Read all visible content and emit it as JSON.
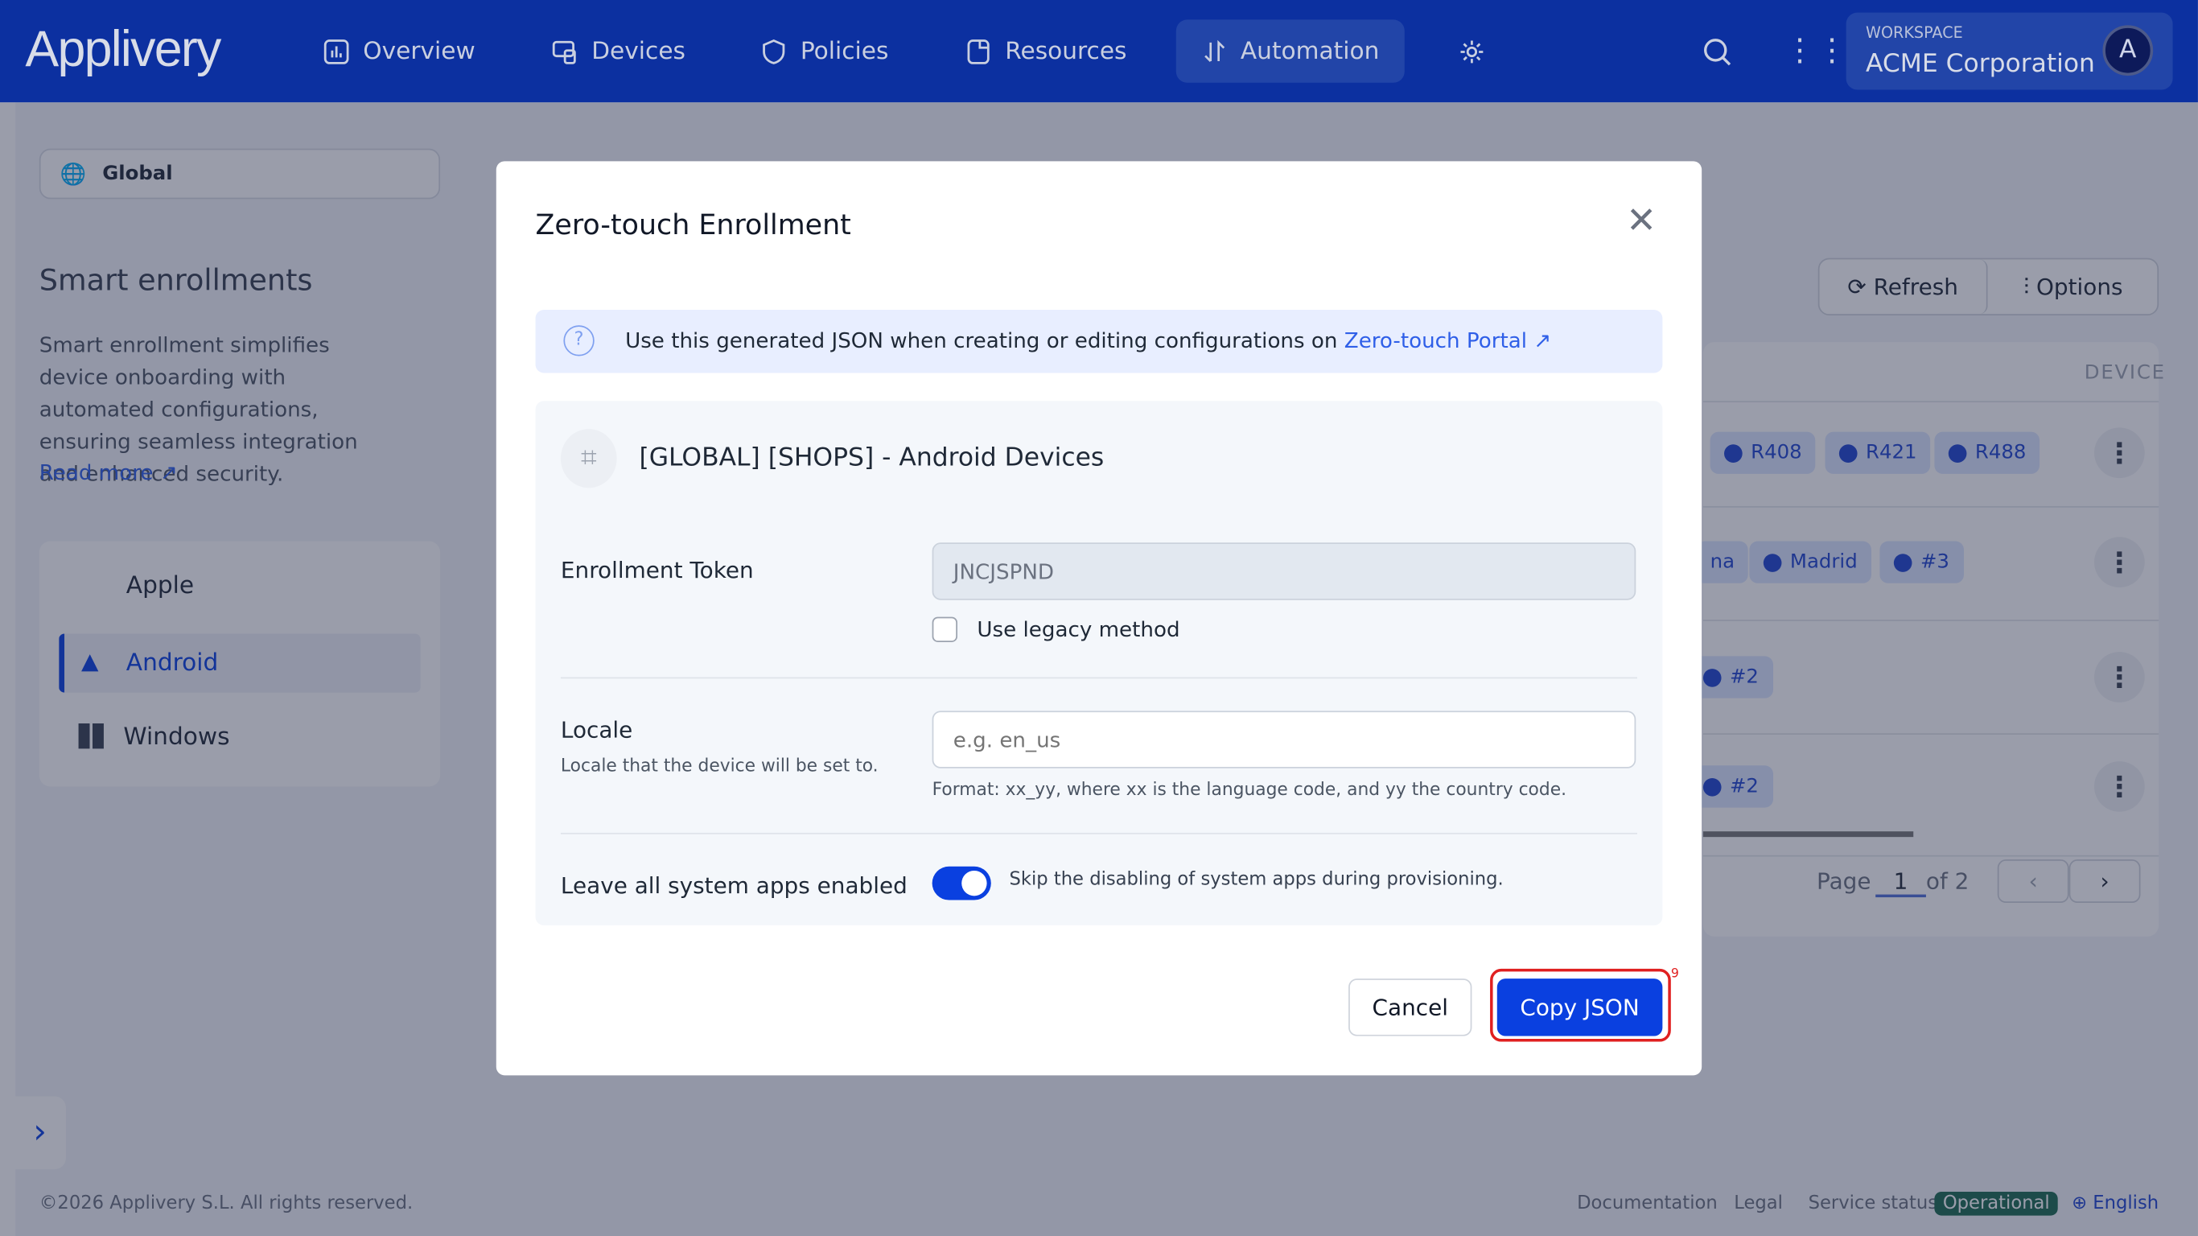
{
  "header": {
    "logo": "Applivery",
    "nav": [
      {
        "label": "Overview",
        "icon": "chart-icon"
      },
      {
        "label": "Devices",
        "icon": "devices-icon"
      },
      {
        "label": "Policies",
        "icon": "shield-icon"
      },
      {
        "label": "Resources",
        "icon": "folder-icon"
      },
      {
        "label": "Automation",
        "icon": "automation-icon",
        "active": true
      }
    ],
    "workspace_label": "WORKSPACE",
    "workspace_name": "ACME Corporation",
    "avatar": "A"
  },
  "sidebar": {
    "scope": "Global",
    "title": "Smart enrollments",
    "description": "Smart enrollment simplifies device onboarding with automated configurations, ensuring seamless integration and enhanced security.",
    "read_more": "Read more",
    "platforms": [
      {
        "label": "Apple"
      },
      {
        "label": "Android",
        "active": true
      },
      {
        "label": "Windows"
      }
    ]
  },
  "toolbar": {
    "refresh": "Refresh",
    "options": "Options"
  },
  "table": {
    "column": "DEVICE",
    "rows": [
      [
        "R408",
        "R421",
        "R488"
      ],
      [
        "na",
        "Madrid",
        "#3"
      ],
      [
        "#2"
      ],
      [
        "#2"
      ]
    ]
  },
  "pagination": {
    "page_label": "Page",
    "page": "1",
    "of": "of 2"
  },
  "footer": {
    "copyright": "©2026 Applivery S.L. All rights reserved.",
    "documentation": "Documentation",
    "legal": "Legal",
    "service_status": "Service status",
    "status": "Operational",
    "language": "English"
  },
  "modal": {
    "title": "Zero-touch Enrollment",
    "info": "Use this generated JSON when creating or editing configurations on ",
    "info_link": "Zero-touch Portal",
    "config_name": "[GLOBAL] [SHOPS] - Android Devices",
    "token_label": "Enrollment Token",
    "token_value": "JNCJSPND",
    "legacy_label": "Use legacy method",
    "legacy_checked": false,
    "locale_label": "Locale",
    "locale_help": "Locale that the device will be set to.",
    "locale_placeholder": "e.g. en_us",
    "locale_format": "Format: xx_yy, where xx is the language code, and yy the country code.",
    "system_apps_label": "Leave all system apps enabled",
    "system_apps_help": "Skip the disabling of system apps during provisioning.",
    "system_apps_enabled": true,
    "cancel": "Cancel",
    "copy": "Copy JSON",
    "badge": "9"
  },
  "colors": {
    "header": "#0c30a0",
    "primary": "#0a40e0",
    "link": "#2f5fe8",
    "operational": "#1d6b50"
  }
}
